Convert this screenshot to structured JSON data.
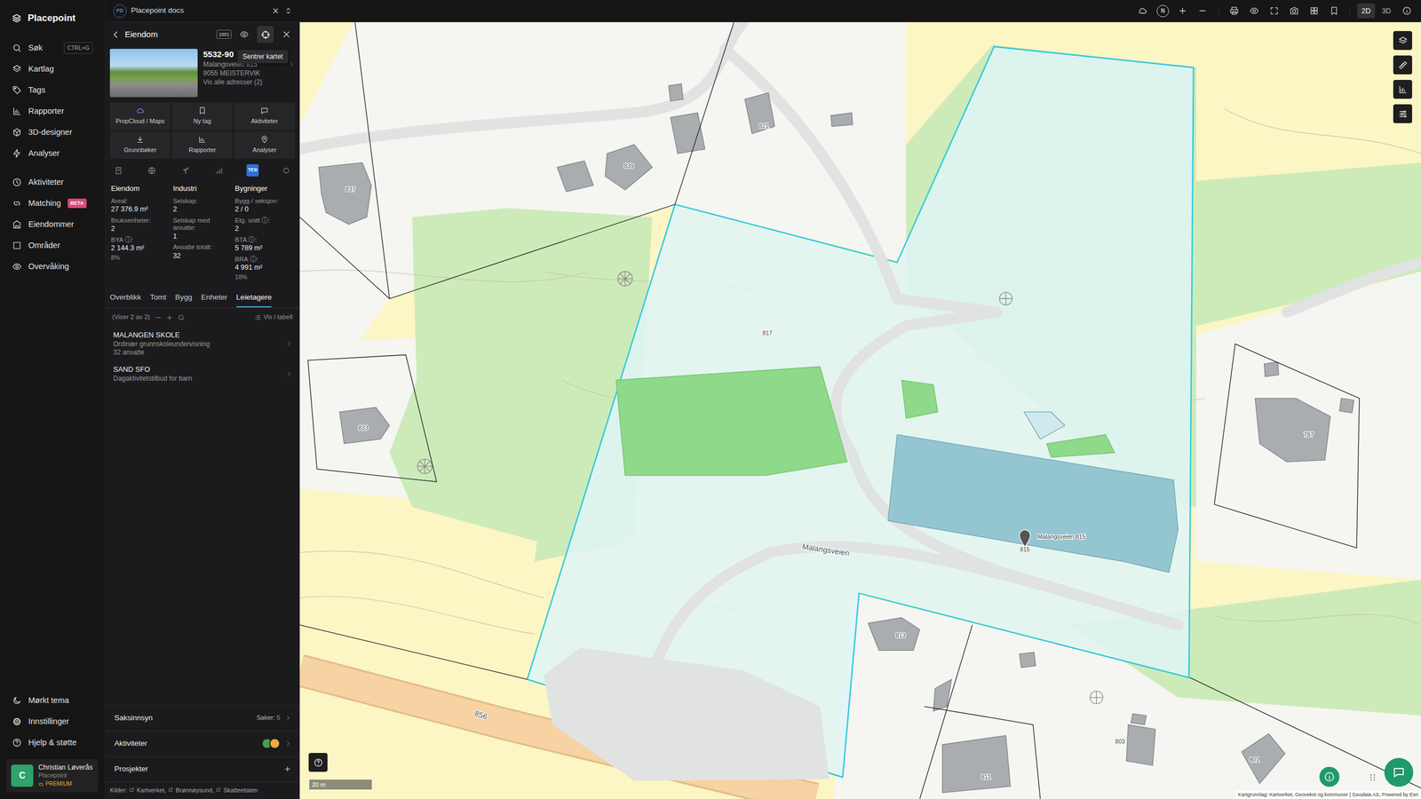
{
  "app": {
    "name": "Placepoint"
  },
  "nav": {
    "main": [
      {
        "label": "Søk",
        "shortcut": "CTRL+G",
        "selected": false
      },
      {
        "label": "Kartlag",
        "selected": false
      },
      {
        "label": "Tags",
        "selected": false
      },
      {
        "label": "Rapporter",
        "selected": false
      },
      {
        "label": "3D-designer",
        "selected": false
      },
      {
        "label": "Analyser",
        "selected": false
      }
    ],
    "secondary": [
      {
        "label": "Aktiviteter",
        "selected": false
      },
      {
        "label": "Matching",
        "badge": "BETA",
        "selected": false
      },
      {
        "label": "Eiendommer",
        "selected": false
      },
      {
        "label": "Områder",
        "selected": false
      },
      {
        "label": "Overvåking",
        "selected": false
      }
    ],
    "bottom": [
      {
        "label": "Mørkt tema"
      },
      {
        "label": "Innstillinger"
      },
      {
        "label": "Hjelp & støtte"
      }
    ]
  },
  "user": {
    "initial": "C",
    "name": "Christian Løverås",
    "org": "Placepoint",
    "plan": "PREMIUM"
  },
  "topbar": {
    "tab": {
      "badge": "PD",
      "title": "Placepoint docs"
    },
    "compass": "N",
    "view_modes": [
      {
        "label": "2D",
        "selected": true
      },
      {
        "label": "3D",
        "selected": false
      }
    ]
  },
  "panel": {
    "title": "Eiendom",
    "badge": "1881",
    "tooltip": "Sentrer kartet",
    "property": {
      "id": "5532-90",
      "address": "Malangsveien 815",
      "postal": "9055 MEISTERVIK",
      "all_addresses": "Vis alle adresser (2)"
    },
    "actions": [
      "PropCloud / Maps",
      "Ny tag",
      "Aktiviteter",
      "Grunnbøker",
      "Rapporter",
      "Analyser"
    ],
    "layer_icons": [
      {
        "kind": "icon",
        "selected": false
      },
      {
        "kind": "icon",
        "selected": false
      },
      {
        "kind": "icon",
        "selected": false
      },
      {
        "kind": "icon",
        "selected": false
      },
      {
        "kind": "text",
        "label": "TEK",
        "selected": true
      },
      {
        "kind": "icon",
        "selected": false
      }
    ],
    "stats": [
      {
        "heading": "Eiendom",
        "fields": [
          {
            "label": "Areal:",
            "value": "27 376.9 m²"
          },
          {
            "label": "Bruksenheter:",
            "value": "2"
          },
          {
            "label": "BYA ⓘ:",
            "value": "2 144.3 m²",
            "note": "8%"
          }
        ]
      },
      {
        "heading": "Industri",
        "fields": [
          {
            "label": "Selskap:",
            "value": "2"
          },
          {
            "label": "Selskap med ansatte:",
            "value": "1"
          },
          {
            "label": "Ansatte totalt:",
            "value": "32"
          }
        ]
      },
      {
        "heading": "Bygninger",
        "fields": [
          {
            "label": "Bygg / seksjon:",
            "value": "2 / 0"
          },
          {
            "label": "Etg. snitt ⓘ:",
            "value": "2"
          },
          {
            "label": "BTA ⓘ:",
            "value": "5 789 m²"
          },
          {
            "label": "BRA ⓘ:",
            "value": "4 991 m²",
            "note": "18%"
          }
        ]
      }
    ],
    "tabs": [
      {
        "label": "Overblikk",
        "selected": false
      },
      {
        "label": "Tomt",
        "selected": false
      },
      {
        "label": "Bygg",
        "selected": false
      },
      {
        "label": "Enheter",
        "selected": false
      },
      {
        "label": "Leietagere",
        "selected": true
      }
    ],
    "list": {
      "count": "(Viser 2 av 2)",
      "table_button": "Vis i tabell",
      "rows": [
        {
          "name": "MALANGEN SKOLE",
          "lines": [
            "Ordinær grunnskoleundervisning",
            "32 ansatte"
          ]
        },
        {
          "name": "SAND SFO",
          "lines": [
            "Dagaktivitetstilbud for barn"
          ]
        }
      ]
    },
    "sections": [
      {
        "label": "Saksinnsyn",
        "kind": "count",
        "count_label": "Saker:",
        "count": "5"
      },
      {
        "label": "Aktiviteter",
        "kind": "avatars",
        "avatars": [
          {
            "color": "#43a047"
          },
          {
            "color": "#f2a93b"
          }
        ]
      },
      {
        "label": "Prosjekter",
        "kind": "add"
      }
    ],
    "sources": {
      "label": "Kilder:",
      "items": [
        "Kartverket,",
        "Brønnøysund,",
        "Skatteetaten"
      ]
    }
  },
  "map": {
    "labels": [
      {
        "text": "821",
        "kind": "house"
      },
      {
        "text": "839",
        "kind": "house"
      },
      {
        "text": "837",
        "kind": "house"
      },
      {
        "text": "817",
        "kind": "house"
      },
      {
        "text": "833",
        "kind": "house"
      },
      {
        "text": "787",
        "kind": "house"
      },
      {
        "text": "813",
        "kind": "house"
      },
      {
        "text": "803",
        "kind": "house"
      },
      {
        "text": "801",
        "kind": "house"
      },
      {
        "text": "811",
        "kind": "house"
      },
      {
        "text": "815",
        "kind": "house"
      },
      {
        "text": "Malangsveien",
        "kind": "road"
      },
      {
        "text": "856",
        "kind": "road"
      },
      {
        "text": "Malangsveien 815",
        "kind": "pin"
      }
    ],
    "scale": "20 m",
    "attribution": "Kartgrunnlag: Kartverket, Geovekst og kommuner | Geodata AS, Powered by Esri"
  }
}
